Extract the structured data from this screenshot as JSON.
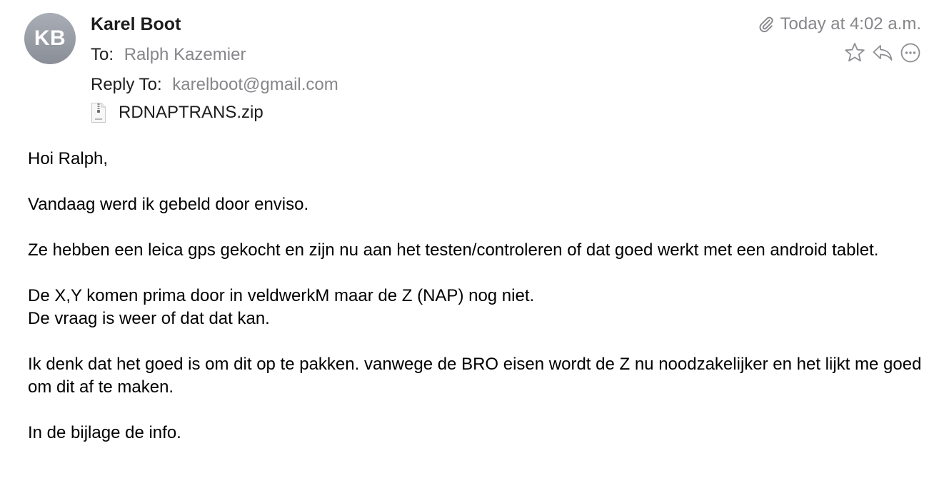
{
  "sender": {
    "initials": "KB",
    "name": "Karel Boot"
  },
  "to": {
    "label": "To:",
    "value": "Ralph Kazemier"
  },
  "reply_to": {
    "label": "Reply To:",
    "value": "karelboot@gmail.com"
  },
  "attachment": {
    "filename": "RDNAPTRANS.zip",
    "icon": "zip-file-icon"
  },
  "timestamp": {
    "text": "Today at 4:02 a.m.",
    "icon": "paperclip-icon"
  },
  "actions": {
    "flag_icon": "star-icon",
    "reply_icon": "reply-icon",
    "more_icon": "more-icon"
  },
  "body": {
    "greeting": "Hoi Ralph,",
    "p1": "Vandaag werd ik gebeld door enviso.",
    "p2": "Ze hebben een leica gps gekocht en zijn nu aan het testen/controleren of dat goed werkt met een android tablet.",
    "p3_line1": "De X,Y komen prima door in veldwerkM maar de Z (NAP) nog niet.",
    "p3_line2": "De vraag is weer of dat dat kan.",
    "p4": "Ik denk dat het goed is om dit op te pakken. vanwege de BRO eisen wordt de Z nu noodzakelijker en het lijkt me goed om dit af te maken.",
    "p5": "In de bijlage de info."
  },
  "colors": {
    "avatar": "#9a9ea6",
    "muted": "#86868b",
    "text": "#1d1d1f"
  }
}
